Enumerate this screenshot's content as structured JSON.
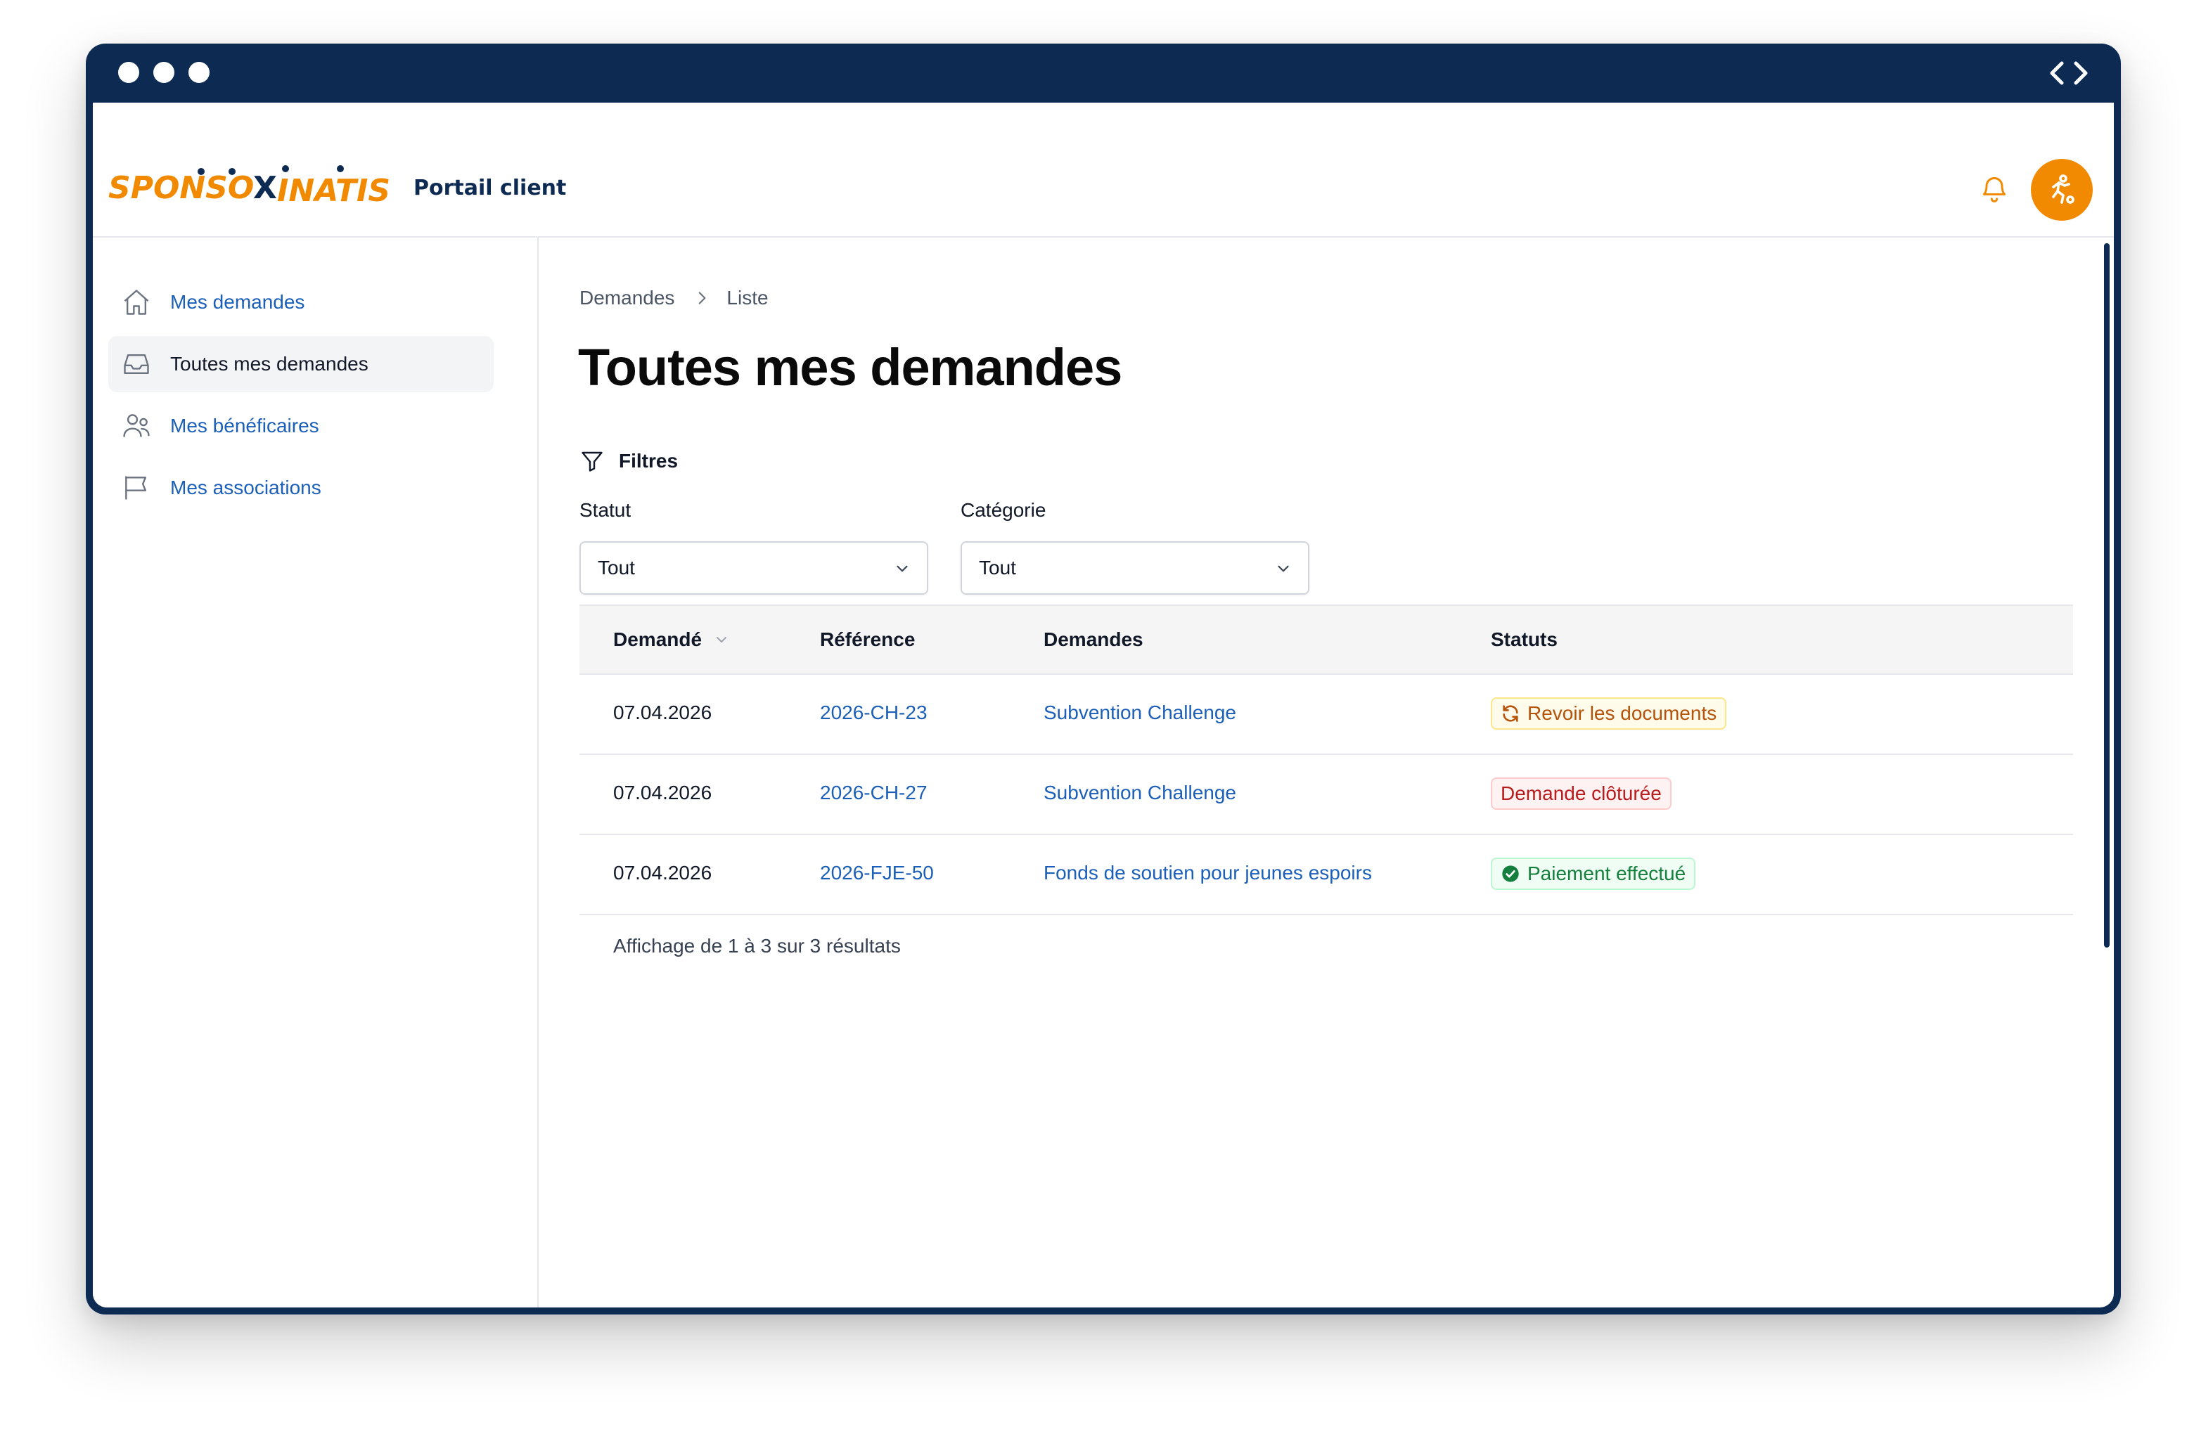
{
  "header": {
    "logo_text": "SPONSOXINATIS",
    "portal_title": "Portail client"
  },
  "sidebar": {
    "items": [
      {
        "label": "Mes demandes",
        "icon": "home-icon",
        "active": false
      },
      {
        "label": "Toutes mes demandes",
        "icon": "inbox-icon",
        "active": true
      },
      {
        "label": "Mes bénéficaires",
        "icon": "users-icon",
        "active": false
      },
      {
        "label": "Mes associations",
        "icon": "flag-icon",
        "active": false
      }
    ]
  },
  "breadcrumb": {
    "root": "Demandes",
    "current": "Liste"
  },
  "page_title": "Toutes mes demandes",
  "filters": {
    "heading": "Filtres",
    "status": {
      "label": "Statut",
      "value": "Tout"
    },
    "category": {
      "label": "Catégorie",
      "value": "Tout"
    }
  },
  "table": {
    "headers": [
      "Demandé",
      "Référence",
      "Demandes",
      "Statuts"
    ],
    "rows": [
      {
        "date": "07.04.2026",
        "reference": "2026-CH-23",
        "request": "Subvention Challenge",
        "status": "Revoir les documents",
        "status_type": "warning"
      },
      {
        "date": "07.04.2026",
        "reference": "2026-CH-27",
        "request": "Subvention Challenge",
        "status": "Demande clôturée",
        "status_type": "danger"
      },
      {
        "date": "07.04.2026",
        "reference": "2026-FJE-50",
        "request": "Fonds de soutien pour jeunes espoirs",
        "status": "Paiement effectué",
        "status_type": "success"
      }
    ],
    "footer": "Affichage de 1 à 3 sur 3 résultats"
  },
  "colors": {
    "brand_navy": "#0c2a52",
    "brand_orange": "#f18a00",
    "link_blue": "#1c5fb8"
  }
}
